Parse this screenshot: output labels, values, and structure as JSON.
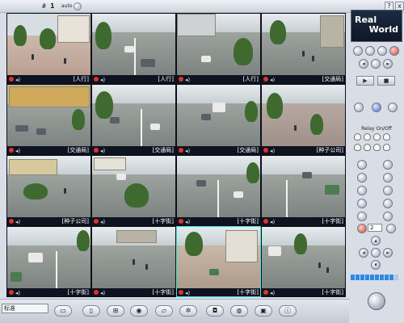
{
  "topbar": {
    "hash": "#",
    "channel": "1",
    "auto_label": "auto",
    "help_label": "?",
    "close_label": "x"
  },
  "logo": {
    "line1": "Real",
    "line2": "World"
  },
  "cameras": [
    {
      "caption": "[人行]"
    },
    {
      "caption": "[人行]"
    },
    {
      "caption": "[人行]"
    },
    {
      "caption": "[交通局]"
    },
    {
      "caption": "[交通局]"
    },
    {
      "caption": "[交通局]"
    },
    {
      "caption": "[交通局]"
    },
    {
      "caption": "[种子公司]"
    },
    {
      "caption": "[种子公司]"
    },
    {
      "caption": "[十字街]"
    },
    {
      "caption": "[十字街]"
    },
    {
      "caption": "[十字街]"
    },
    {
      "caption": "[十字街]"
    },
    {
      "caption": "[十字街]"
    },
    {
      "caption": "[十字街]"
    },
    {
      "caption": "[十字街]"
    }
  ],
  "relay": {
    "label": "Relay On/Off"
  },
  "preset": {
    "value": "2"
  },
  "status_bar": {
    "mode": "标准"
  },
  "volume": {
    "level_percent": 90
  },
  "toolbar_icons": [
    "single-view-icon",
    "single-view-icon",
    "quad-view-icon",
    "record-icon",
    "folder-icon",
    "settings-icon",
    "camera-icon",
    "network-icon",
    "playback-icon",
    "info-icon"
  ]
}
